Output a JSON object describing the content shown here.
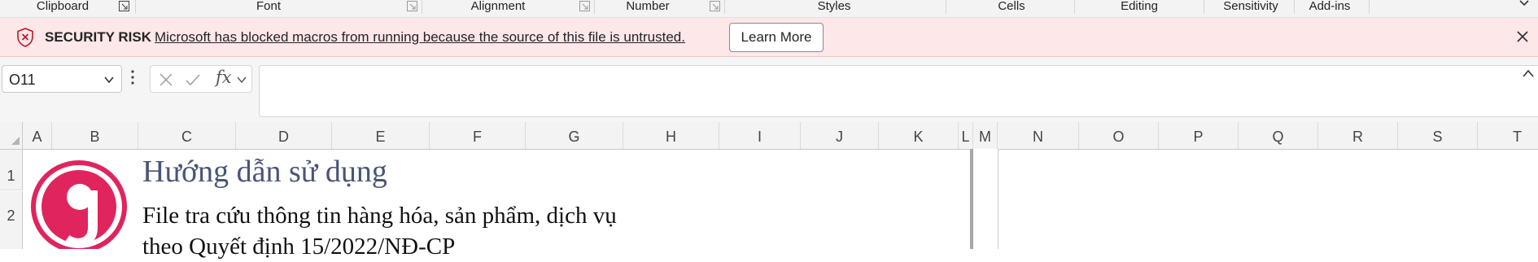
{
  "ribbon": {
    "groups": [
      {
        "label": "Clipboard"
      },
      {
        "label": "Font"
      },
      {
        "label": "Alignment"
      },
      {
        "label": "Number"
      },
      {
        "label": "Styles"
      },
      {
        "label": "Cells"
      },
      {
        "label": "Editing"
      },
      {
        "label": "Sensitivity"
      },
      {
        "label": "Add-ins"
      }
    ]
  },
  "security_bar": {
    "title": "SECURITY RISK",
    "message": "Microsoft has blocked macros from running because the source of this file is untrusted.",
    "button": "Learn More",
    "color": "#fde7e9"
  },
  "formula_bar": {
    "name_box": "O11",
    "fx": "fx",
    "formula": ""
  },
  "sheet": {
    "columns": [
      "A",
      "B",
      "C",
      "D",
      "E",
      "F",
      "G",
      "H",
      "I",
      "J",
      "K",
      "L",
      "M",
      "N",
      "O",
      "P",
      "Q",
      "R",
      "S",
      "T"
    ],
    "rows": [
      "1",
      "2"
    ],
    "title": "Hướng dẫn sử dụng",
    "subtitle_line1": "File tra cứu thông tin hàng hóa, sản phẩm, dịch vụ",
    "subtitle_line2": "theo Quyết định 15/2022/NĐ-CP",
    "logo_color": "#e0245e",
    "title_color": "#4a5478"
  }
}
